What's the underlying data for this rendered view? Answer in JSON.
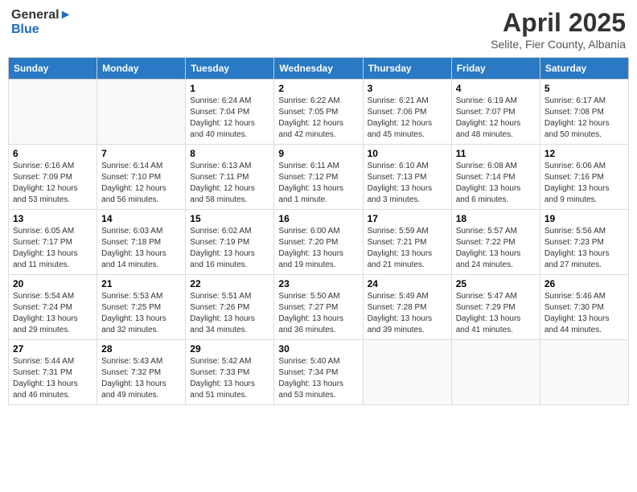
{
  "header": {
    "logo_general": "General",
    "logo_blue": "Blue",
    "month": "April 2025",
    "location": "Selite, Fier County, Albania"
  },
  "weekdays": [
    "Sunday",
    "Monday",
    "Tuesday",
    "Wednesday",
    "Thursday",
    "Friday",
    "Saturday"
  ],
  "weeks": [
    [
      {
        "day": "",
        "sunrise": "",
        "sunset": "",
        "daylight": ""
      },
      {
        "day": "",
        "sunrise": "",
        "sunset": "",
        "daylight": ""
      },
      {
        "day": "1",
        "sunrise": "Sunrise: 6:24 AM",
        "sunset": "Sunset: 7:04 PM",
        "daylight": "Daylight: 12 hours and 40 minutes."
      },
      {
        "day": "2",
        "sunrise": "Sunrise: 6:22 AM",
        "sunset": "Sunset: 7:05 PM",
        "daylight": "Daylight: 12 hours and 42 minutes."
      },
      {
        "day": "3",
        "sunrise": "Sunrise: 6:21 AM",
        "sunset": "Sunset: 7:06 PM",
        "daylight": "Daylight: 12 hours and 45 minutes."
      },
      {
        "day": "4",
        "sunrise": "Sunrise: 6:19 AM",
        "sunset": "Sunset: 7:07 PM",
        "daylight": "Daylight: 12 hours and 48 minutes."
      },
      {
        "day": "5",
        "sunrise": "Sunrise: 6:17 AM",
        "sunset": "Sunset: 7:08 PM",
        "daylight": "Daylight: 12 hours and 50 minutes."
      }
    ],
    [
      {
        "day": "6",
        "sunrise": "Sunrise: 6:16 AM",
        "sunset": "Sunset: 7:09 PM",
        "daylight": "Daylight: 12 hours and 53 minutes."
      },
      {
        "day": "7",
        "sunrise": "Sunrise: 6:14 AM",
        "sunset": "Sunset: 7:10 PM",
        "daylight": "Daylight: 12 hours and 56 minutes."
      },
      {
        "day": "8",
        "sunrise": "Sunrise: 6:13 AM",
        "sunset": "Sunset: 7:11 PM",
        "daylight": "Daylight: 12 hours and 58 minutes."
      },
      {
        "day": "9",
        "sunrise": "Sunrise: 6:11 AM",
        "sunset": "Sunset: 7:12 PM",
        "daylight": "Daylight: 13 hours and 1 minute."
      },
      {
        "day": "10",
        "sunrise": "Sunrise: 6:10 AM",
        "sunset": "Sunset: 7:13 PM",
        "daylight": "Daylight: 13 hours and 3 minutes."
      },
      {
        "day": "11",
        "sunrise": "Sunrise: 6:08 AM",
        "sunset": "Sunset: 7:14 PM",
        "daylight": "Daylight: 13 hours and 6 minutes."
      },
      {
        "day": "12",
        "sunrise": "Sunrise: 6:06 AM",
        "sunset": "Sunset: 7:16 PM",
        "daylight": "Daylight: 13 hours and 9 minutes."
      }
    ],
    [
      {
        "day": "13",
        "sunrise": "Sunrise: 6:05 AM",
        "sunset": "Sunset: 7:17 PM",
        "daylight": "Daylight: 13 hours and 11 minutes."
      },
      {
        "day": "14",
        "sunrise": "Sunrise: 6:03 AM",
        "sunset": "Sunset: 7:18 PM",
        "daylight": "Daylight: 13 hours and 14 minutes."
      },
      {
        "day": "15",
        "sunrise": "Sunrise: 6:02 AM",
        "sunset": "Sunset: 7:19 PM",
        "daylight": "Daylight: 13 hours and 16 minutes."
      },
      {
        "day": "16",
        "sunrise": "Sunrise: 6:00 AM",
        "sunset": "Sunset: 7:20 PM",
        "daylight": "Daylight: 13 hours and 19 minutes."
      },
      {
        "day": "17",
        "sunrise": "Sunrise: 5:59 AM",
        "sunset": "Sunset: 7:21 PM",
        "daylight": "Daylight: 13 hours and 21 minutes."
      },
      {
        "day": "18",
        "sunrise": "Sunrise: 5:57 AM",
        "sunset": "Sunset: 7:22 PM",
        "daylight": "Daylight: 13 hours and 24 minutes."
      },
      {
        "day": "19",
        "sunrise": "Sunrise: 5:56 AM",
        "sunset": "Sunset: 7:23 PM",
        "daylight": "Daylight: 13 hours and 27 minutes."
      }
    ],
    [
      {
        "day": "20",
        "sunrise": "Sunrise: 5:54 AM",
        "sunset": "Sunset: 7:24 PM",
        "daylight": "Daylight: 13 hours and 29 minutes."
      },
      {
        "day": "21",
        "sunrise": "Sunrise: 5:53 AM",
        "sunset": "Sunset: 7:25 PM",
        "daylight": "Daylight: 13 hours and 32 minutes."
      },
      {
        "day": "22",
        "sunrise": "Sunrise: 5:51 AM",
        "sunset": "Sunset: 7:26 PM",
        "daylight": "Daylight: 13 hours and 34 minutes."
      },
      {
        "day": "23",
        "sunrise": "Sunrise: 5:50 AM",
        "sunset": "Sunset: 7:27 PM",
        "daylight": "Daylight: 13 hours and 36 minutes."
      },
      {
        "day": "24",
        "sunrise": "Sunrise: 5:49 AM",
        "sunset": "Sunset: 7:28 PM",
        "daylight": "Daylight: 13 hours and 39 minutes."
      },
      {
        "day": "25",
        "sunrise": "Sunrise: 5:47 AM",
        "sunset": "Sunset: 7:29 PM",
        "daylight": "Daylight: 13 hours and 41 minutes."
      },
      {
        "day": "26",
        "sunrise": "Sunrise: 5:46 AM",
        "sunset": "Sunset: 7:30 PM",
        "daylight": "Daylight: 13 hours and 44 minutes."
      }
    ],
    [
      {
        "day": "27",
        "sunrise": "Sunrise: 5:44 AM",
        "sunset": "Sunset: 7:31 PM",
        "daylight": "Daylight: 13 hours and 46 minutes."
      },
      {
        "day": "28",
        "sunrise": "Sunrise: 5:43 AM",
        "sunset": "Sunset: 7:32 PM",
        "daylight": "Daylight: 13 hours and 49 minutes."
      },
      {
        "day": "29",
        "sunrise": "Sunrise: 5:42 AM",
        "sunset": "Sunset: 7:33 PM",
        "daylight": "Daylight: 13 hours and 51 minutes."
      },
      {
        "day": "30",
        "sunrise": "Sunrise: 5:40 AM",
        "sunset": "Sunset: 7:34 PM",
        "daylight": "Daylight: 13 hours and 53 minutes."
      },
      {
        "day": "",
        "sunrise": "",
        "sunset": "",
        "daylight": ""
      },
      {
        "day": "",
        "sunrise": "",
        "sunset": "",
        "daylight": ""
      },
      {
        "day": "",
        "sunrise": "",
        "sunset": "",
        "daylight": ""
      }
    ]
  ]
}
